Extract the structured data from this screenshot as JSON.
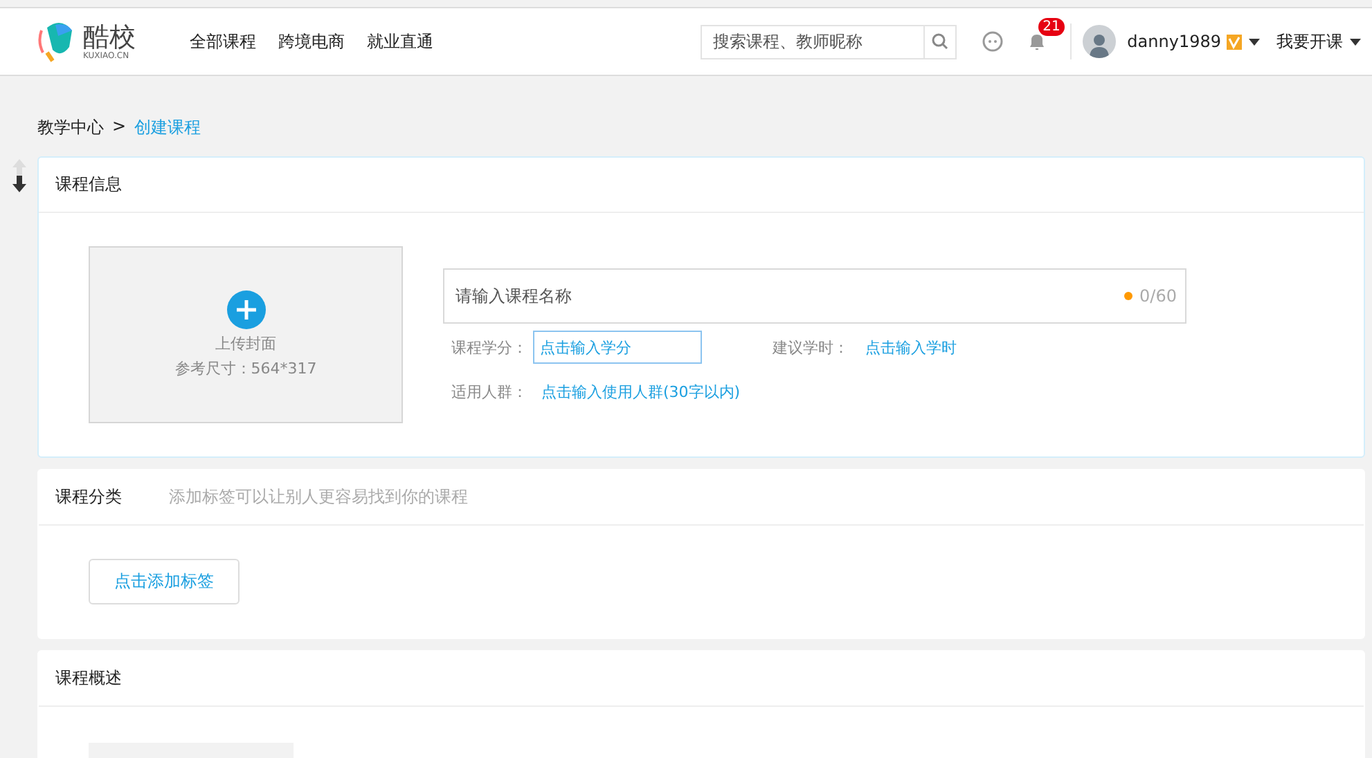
{
  "header": {
    "logo": {
      "name": "酷校",
      "sub": "KUXIAO.CN"
    },
    "nav": [
      "全部课程",
      "跨境电商",
      "就业直通"
    ],
    "search": {
      "placeholder": "搜索课程、教师昵称"
    },
    "notifications": {
      "count": "21"
    },
    "user": {
      "name": "danny1989"
    },
    "teach_menu": "我要开课"
  },
  "breadcrumb": [
    {
      "label": "教学中心",
      "selected": false
    },
    {
      "label": "创建课程",
      "selected": true
    }
  ],
  "breadcrumb_separator": ">",
  "course_info": {
    "title": "课程信息",
    "cover": {
      "label": "上传封面",
      "hint": "参考尺寸：564*317"
    },
    "name_field": {
      "placeholder": "请输入课程名称",
      "counter": "0/60"
    },
    "credit": {
      "label": "课程学分：",
      "placeholder": "点击输入学分"
    },
    "hours": {
      "label": "建议学时：",
      "link": "点击输入学时"
    },
    "audience": {
      "label": "适用人群：",
      "link": "点击输入使用人群(30字以内)"
    }
  },
  "category": {
    "title": "课程分类",
    "hint": "添加标签可以让别人更容易找到你的课程",
    "button": "点击添加标签"
  },
  "overview": {
    "title": "课程概述"
  }
}
